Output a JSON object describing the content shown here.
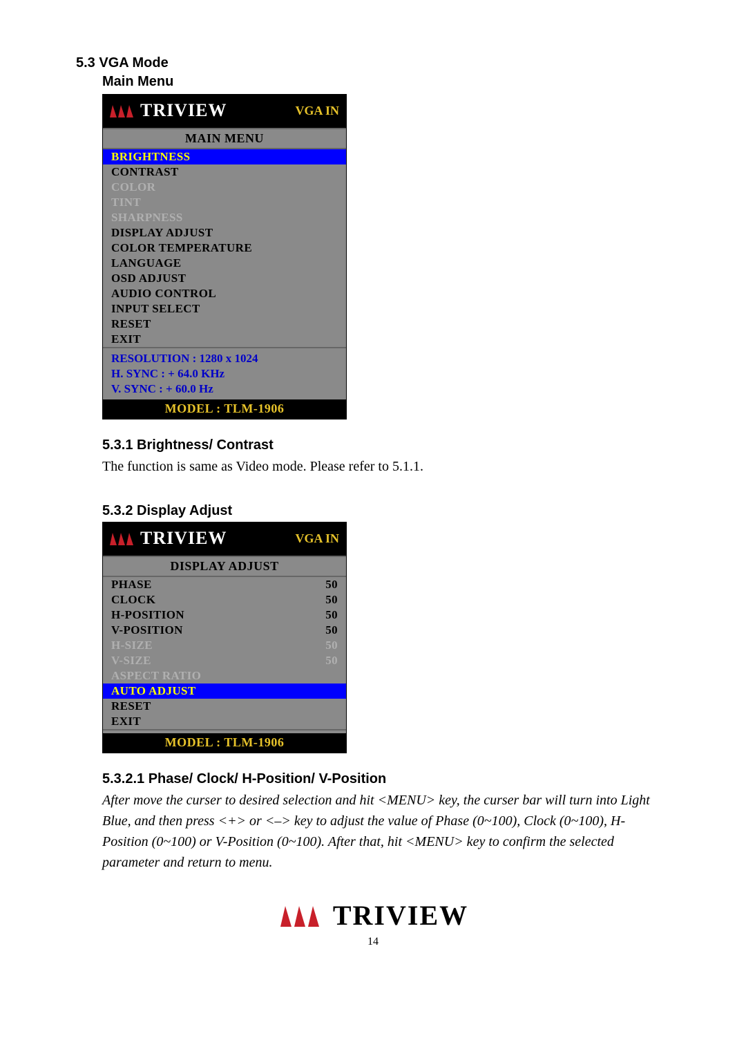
{
  "headings": {
    "h1": "5.3 VGA Mode",
    "h2_main": "Main Menu",
    "s1": "5.3.1 Brightness/ Contrast",
    "s1_text": "The function is same as Video mode. Please refer to 5.1.1.",
    "s2": "5.3.2 Display Adjust",
    "s3": "5.3.2.1 Phase/ Clock/ H-Position/ V-Position",
    "s3_text": "After move the curser to desired selection and hit <MENU> key, the curser bar will turn into Light Blue, and then press <+> or <–> key to adjust the value of Phase (0~100), Clock (0~100), H-Position (0~100) or V-Position (0~100). After that, hit <MENU> key to confirm the selected parameter and return to menu."
  },
  "brand": "TRIVIEW",
  "input_source": "VGA IN",
  "model_line": "MODEL : TLM-1906",
  "main_menu": {
    "title": "MAIN MENU",
    "items": [
      {
        "label": "BRIGHTNESS",
        "sel": true
      },
      {
        "label": "CONTRAST"
      },
      {
        "label": "COLOR",
        "dis": true
      },
      {
        "label": "TINT",
        "dis": true
      },
      {
        "label": "SHARPNESS",
        "dis": true
      },
      {
        "label": "DISPLAY ADJUST"
      },
      {
        "label": "COLOR TEMPERATURE"
      },
      {
        "label": "LANGUAGE"
      },
      {
        "label": "OSD ADJUST"
      },
      {
        "label": "AUDIO CONTROL"
      },
      {
        "label": "INPUT SELECT"
      },
      {
        "label": "RESET"
      },
      {
        "label": "EXIT"
      }
    ],
    "info": [
      "RESOLUTION : 1280 x 1024",
      "H. SYNC : + 64.0 KHz",
      "V. SYNC : + 60.0 Hz"
    ]
  },
  "display_adjust": {
    "title": "DISPLAY ADJUST",
    "items": [
      {
        "label": "PHASE",
        "value": "50"
      },
      {
        "label": "CLOCK",
        "value": "50"
      },
      {
        "label": "H-POSITION",
        "value": "50"
      },
      {
        "label": "V-POSITION",
        "value": "50"
      },
      {
        "label": "H-SIZE",
        "value": "50",
        "dis": true
      },
      {
        "label": "V-SIZE",
        "value": "50",
        "dis": true
      },
      {
        "label": "ASPECT RATIO",
        "dis": true
      },
      {
        "label": "AUTO ADJUST",
        "sel": true
      },
      {
        "label": "RESET"
      },
      {
        "label": "EXIT"
      }
    ]
  },
  "page_number": "14"
}
